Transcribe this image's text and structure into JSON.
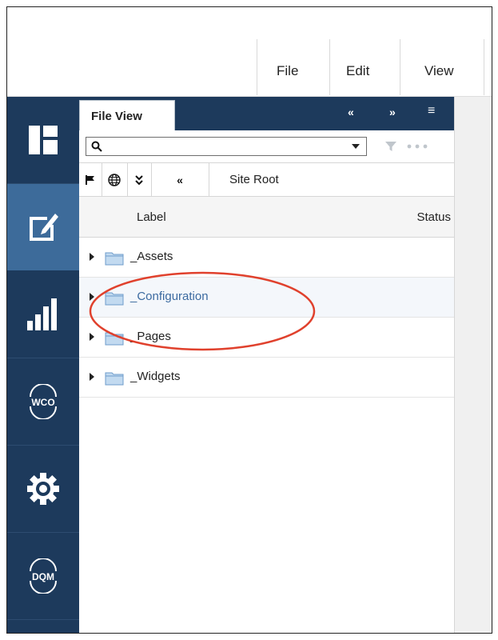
{
  "menubar": {
    "items": [
      "File",
      "Edit",
      "View"
    ]
  },
  "rail": {
    "items": [
      {
        "name": "layout-icon",
        "active": false
      },
      {
        "name": "edit-icon",
        "active": true
      },
      {
        "name": "analytics-icon",
        "active": false
      },
      {
        "name": "wco-icon",
        "label": "WCO",
        "active": false
      },
      {
        "name": "gear-icon",
        "active": false
      },
      {
        "name": "dqm-icon",
        "label": "DQM",
        "active": false
      }
    ]
  },
  "panel": {
    "tab_label": "File View",
    "header_buttons": [
      "collapse-left",
      "collapse-right",
      "menu"
    ]
  },
  "search": {
    "value": "",
    "placeholder": ""
  },
  "toolbar": {
    "site_root_label": "Site Root"
  },
  "columns": {
    "label": "Label",
    "status": "Status"
  },
  "tree": {
    "rows": [
      {
        "label": "_Assets",
        "selected": false
      },
      {
        "label": "_Configuration",
        "selected": true
      },
      {
        "label": "_Pages",
        "selected": false
      },
      {
        "label": "_Widgets",
        "selected": false
      }
    ]
  },
  "colors": {
    "rail_bg": "#1d3a5c",
    "rail_active": "#3d6b9a",
    "link": "#3b6aa0",
    "annotation": "#e0412d"
  }
}
